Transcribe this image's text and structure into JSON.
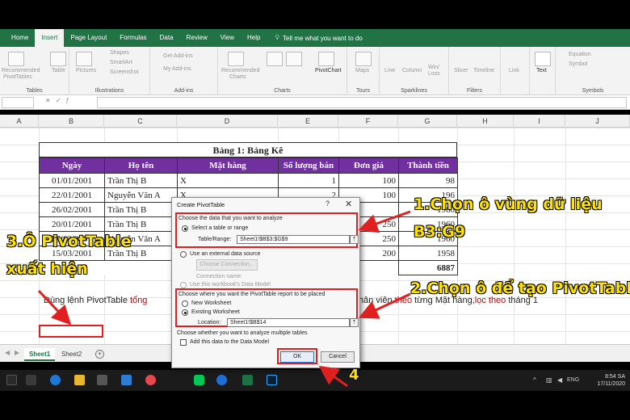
{
  "ribbon_tabs": [
    "Home",
    "Insert",
    "Page Layout",
    "Formulas",
    "Data",
    "Review",
    "View",
    "Help"
  ],
  "active_tab": "Insert",
  "tell_me": "Tell me what you want to do",
  "ribbon_groups": {
    "tables": "Tables",
    "illustrations": "Illustrations",
    "addins": "Add-ins",
    "charts": "Charts",
    "tours": "Tours",
    "sparklines": "Sparklines",
    "filters": "Filters",
    "symbols": "Symbols"
  },
  "ribbon_items": {
    "recommended": "Recommended",
    "pivottables": "PivotTables",
    "table": "Table",
    "pictures": "Pictures",
    "shapes": "Shapes",
    "smartart": "SmartArt",
    "screenshot": "Screenshot",
    "get_addins": "Get Add-ins",
    "my_addins": "My Add-ins",
    "recommended_charts_1": "Recommended",
    "recommended_charts_2": "Charts",
    "pivotchart": "PivotChart",
    "maps": "Maps",
    "line": "Line",
    "column": "Column",
    "winloss": "Win/",
    "winloss2": "Loss",
    "slicer": "Slicer",
    "timeline": "Timeline",
    "link": "Link",
    "text": "Text",
    "equation": "Equation",
    "symbol": "Symbol"
  },
  "columns": [
    "A",
    "B",
    "C",
    "D",
    "E",
    "F",
    "G",
    "H",
    "I",
    "J"
  ],
  "table": {
    "title": "Bảng 1: Bảng Kê",
    "headers": [
      "Ngày",
      "Họ tên",
      "Mặt hàng",
      "Số lượng bán",
      "Đơn giá",
      "Thành tiền"
    ],
    "rows": [
      [
        "01/01/2001",
        "Trần Thị B",
        "X",
        "1",
        "100",
        "98"
      ],
      [
        "22/01/2001",
        "Nguyễn Văn A",
        "X",
        "2",
        "100",
        "196"
      ],
      [
        "26/02/2001",
        "Trần Thị B",
        "",
        "",
        "",
        "1960"
      ],
      [
        "20/01/2001",
        "Trần Thị B",
        "",
        "",
        "250",
        "1960"
      ],
      [
        "25/02/2001",
        "Nguyễn Văn A",
        "",
        "",
        "250",
        "1960"
      ],
      [
        "15/03/2001",
        "Trần Thị B",
        "",
        "",
        "200",
        "1958"
      ]
    ],
    "total": "6887"
  },
  "note": {
    "prefix": "Dùng lệnh PivotTable ",
    "red": "tổng",
    "right_a": "hân viên ",
    "right_b": "theo",
    "right_c": " từng Mặt hàng,",
    "right_d": "lọc theo",
    "right_e": " tháng 1"
  },
  "sheets": [
    "Sheet1",
    "Sheet2"
  ],
  "tray": {
    "lang": "ENG",
    "time": "8:54 SA",
    "date": "17/11/2020"
  },
  "dialog": {
    "title": "Create PivotTable",
    "help": "?",
    "close": "✕",
    "sec1_label": "Choose the data that you want to analyze",
    "opt_select_range": "Select a table or range",
    "table_range_label": "Table/Range:",
    "table_range_value": "Sheet1!$B$3:$G$9",
    "opt_external": "Use an external data source",
    "choose_connection": "Choose Connection...",
    "connection_name": "Connection name:",
    "opt_data_model": "Use this workbook's Data Model",
    "sec2_label": "Choose where you want the PivotTable report to be placed",
    "opt_new_ws": "New Worksheet",
    "opt_existing_ws": "Existing Worksheet",
    "location_label": "Location:",
    "location_value": "Sheet1!$B$14",
    "sec3_label": "Choose whether you want to analyze multiple tables",
    "add_data_model": "Add this data to the Data Model",
    "ok": "OK",
    "cancel": "Cancel"
  },
  "annotations": {
    "step1_line1": "1.Chọn ô vùng dữ liệu",
    "step1_line2": "B3:G9",
    "step2": "2.Chọn ô để tạo PivotTable",
    "step3_line1": "3.Ô PivotTable",
    "step3_line2": "xuất hiện",
    "step4": "4"
  },
  "colors": {
    "excel_green": "#217346",
    "header_purple": "#7030a0",
    "annotation_yellow": "#ffe100",
    "highlight_red": "#e02020"
  }
}
